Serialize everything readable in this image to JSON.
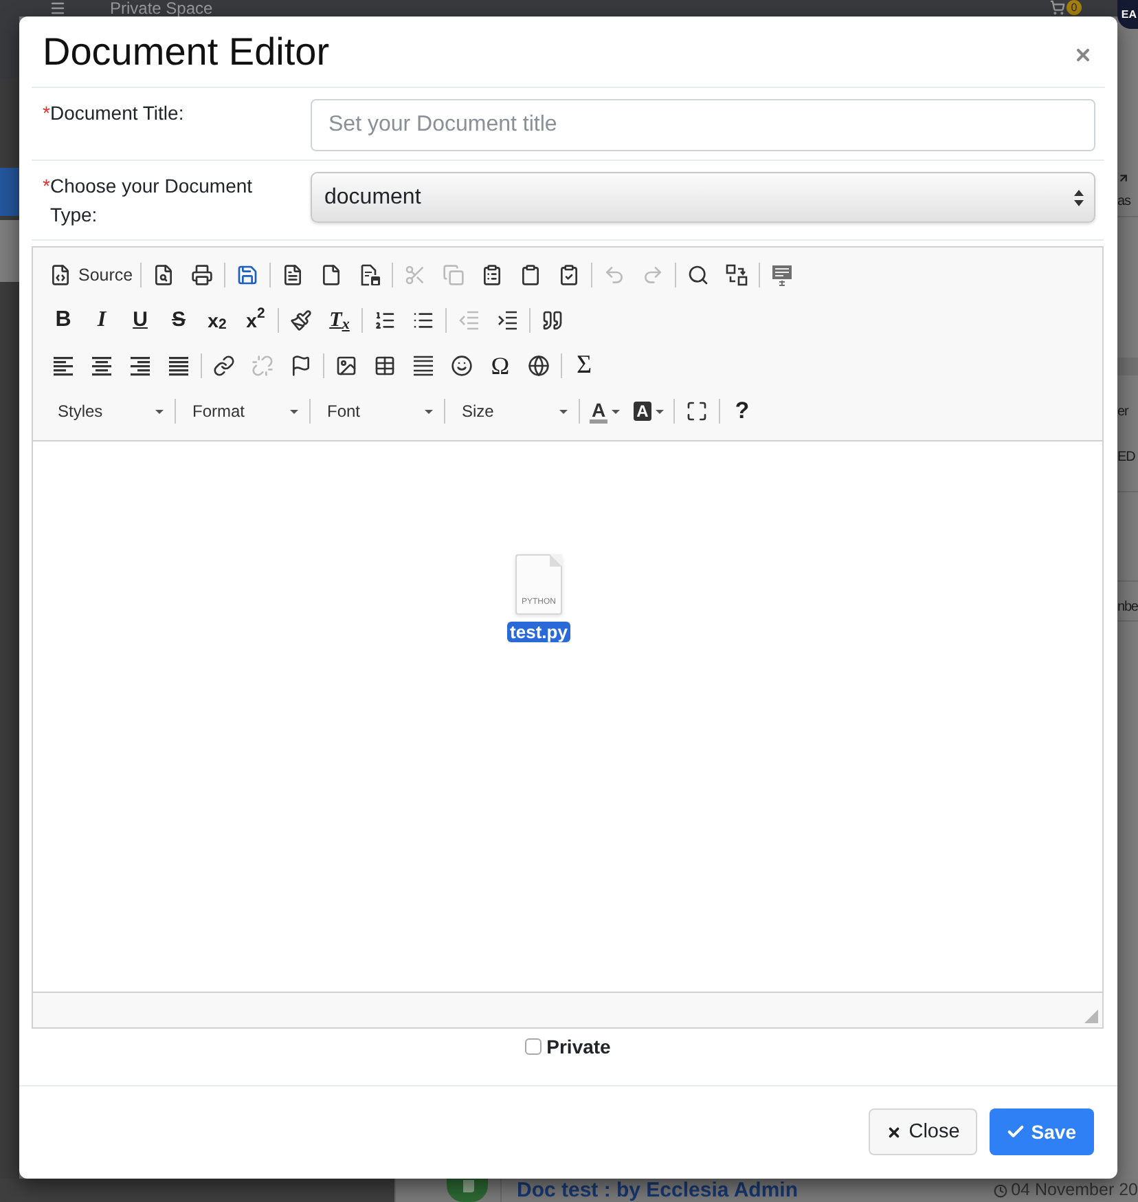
{
  "background_page": {
    "top_bar": {
      "title": "Private Space",
      "cart_badge": "0",
      "avatar_initials": "EA"
    },
    "side_texts": [
      "as",
      "er",
      "ED",
      "nbe"
    ],
    "list_row": {
      "title": "Doc test : by Ecclesia Admin",
      "date": "04 November 20"
    }
  },
  "dialog": {
    "title": "Document Editor",
    "fields": [
      {
        "kind": "text",
        "required_mark": "*",
        "label": "Document Title:",
        "placeholder": "Set your Document title"
      },
      {
        "kind": "select",
        "required_mark": "*",
        "label": "Choose your Document Type:",
        "value": "document"
      }
    ],
    "editor": {
      "toolbar": [
        [
          [
            {
              "kind": "labeled",
              "label": "Source",
              "disabled": false
            }
          ],
          [
            {
              "kind": "icon",
              "disabled": false
            },
            {
              "kind": "icon",
              "disabled": false
            }
          ],
          [
            {
              "kind": "icon",
              "disabled": false
            }
          ],
          [
            {
              "kind": "icon",
              "disabled": false
            },
            {
              "kind": "icon",
              "disabled": false
            },
            {
              "kind": "icon",
              "disabled": false
            }
          ],
          [
            {
              "kind": "icon",
              "disabled": true
            },
            {
              "kind": "icon",
              "disabled": true
            },
            {
              "kind": "icon",
              "disabled": false
            },
            {
              "kind": "icon",
              "disabled": false
            },
            {
              "kind": "icon",
              "disabled": false
            }
          ],
          [
            {
              "kind": "icon",
              "disabled": true
            },
            {
              "kind": "icon",
              "disabled": true
            }
          ],
          [
            {
              "kind": "icon",
              "disabled": false
            },
            {
              "kind": "icon",
              "disabled": false
            }
          ],
          [
            {
              "kind": "icon",
              "disabled": false
            }
          ]
        ],
        [
          [
            {
              "kind": "glyph",
              "glyph": "B",
              "disabled": false
            },
            {
              "kind": "glyph",
              "glyph": "I",
              "disabled": false
            },
            {
              "kind": "glyph",
              "glyph": "U",
              "disabled": false
            },
            {
              "kind": "glyph",
              "glyph": "S",
              "disabled": false
            },
            {
              "kind": "glyph",
              "glyph": "x$_{2}$",
              "disabled": false
            },
            {
              "kind": "glyph",
              "glyph": "x$^{2}$",
              "disabled": false
            }
          ],
          [
            {
              "kind": "icon",
              "disabled": false
            },
            {
              "kind": "glyph",
              "glyph": "T$_{x}$",
              "disabled": false
            }
          ],
          [
            {
              "kind": "icon",
              "disabled": false
            },
            {
              "kind": "icon",
              "disabled": false
            }
          ],
          [
            {
              "kind": "icon",
              "disabled": true
            },
            {
              "kind": "icon",
              "disabled": false
            }
          ],
          [
            {
              "kind": "icon",
              "disabled": false
            }
          ]
        ],
        [
          [
            {
              "kind": "icon",
              "disabled": false
            },
            {
              "kind": "icon",
              "disabled": false
            },
            {
              "kind": "icon",
              "disabled": false
            },
            {
              "kind": "icon",
              "disabled": false
            }
          ],
          [
            {
              "kind": "icon",
              "disabled": false
            },
            {
              "kind": "icon",
              "disabled": true
            },
            {
              "kind": "icon",
              "disabled": false
            }
          ],
          [
            {
              "kind": "icon",
              "disabled": false
            },
            {
              "kind": "icon",
              "disabled": false
            },
            {
              "kind": "icon",
              "disabled": false
            },
            {
              "kind": "icon",
              "disabled": false
            },
            {
              "kind": "glyph",
              "glyph": "Ω",
              "disabled": false
            },
            {
              "kind": "icon",
              "disabled": false
            }
          ],
          [
            {
              "kind": "glyph",
              "glyph": "Σ",
              "disabled": false
            }
          ]
        ],
        [
          [
            {
              "kind": "combo",
              "label": "Styles",
              "disabled": false
            }
          ],
          [
            {
              "kind": "combo",
              "label": "Format",
              "disabled": false
            }
          ],
          [
            {
              "kind": "combo",
              "label": "Font",
              "disabled": false
            }
          ],
          [
            {
              "kind": "combo",
              "label": "Size",
              "disabled": false
            }
          ],
          [
            {
              "kind": "fontcolor",
              "glyph": "A",
              "disabled": false
            },
            {
              "kind": "backcolor",
              "glyph": "A",
              "disabled": false
            }
          ],
          [
            {
              "kind": "icon",
              "disabled": false
            }
          ],
          [
            {
              "kind": "glyph",
              "glyph": "?",
              "disabled": false
            }
          ]
        ]
      ],
      "attachment": {
        "file_type": "PYTHON",
        "file_name": "test.py",
        "selected": true
      }
    },
    "private_option": {
      "label": "Private",
      "checked": false
    },
    "buttons": [
      {
        "kind": "secondary",
        "label": "Close"
      },
      {
        "kind": "primary",
        "label": "Save"
      }
    ]
  }
}
